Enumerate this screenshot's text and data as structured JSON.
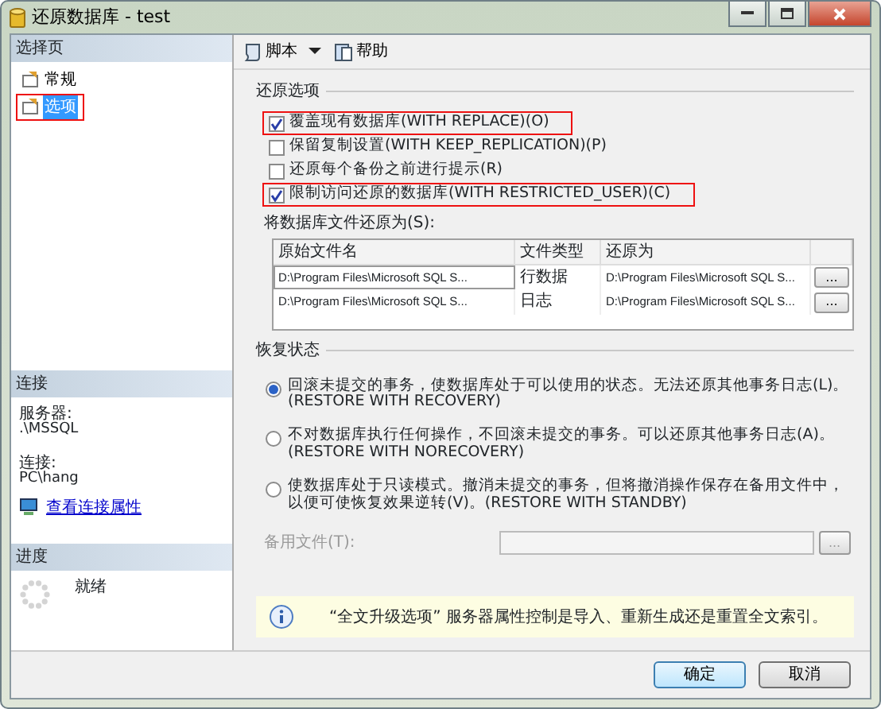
{
  "window": {
    "title": "还原数据库 - test"
  },
  "left": {
    "pages_heading": "选择页",
    "pages": [
      {
        "label": "常规",
        "selected": false,
        "highlighted": false
      },
      {
        "label": "选项",
        "selected": true,
        "highlighted": true
      }
    ],
    "connection_heading": "连接",
    "server_label": "服务器:",
    "server": ".\\MSSQL",
    "connection_label": "连接:",
    "connection": "PC\\hang",
    "link": "查看连接属性",
    "progress_heading": "进度",
    "progress_status": "就绪"
  },
  "toolbar": [
    {
      "label": "脚本",
      "kind": "script"
    },
    {
      "label": "帮助",
      "kind": "help"
    }
  ],
  "restore_options": {
    "heading": "还原选项",
    "checkboxes": [
      {
        "label": "覆盖现有数据库(WITH REPLACE)(O)",
        "checked": true,
        "highlighted": true
      },
      {
        "label": "保留复制设置(WITH KEEP_REPLICATION)(P)",
        "checked": false,
        "highlighted": false
      },
      {
        "label": "还原每个备份之前进行提示(R)",
        "checked": false,
        "highlighted": false
      },
      {
        "label": "限制访问还原的数据库(WITH RESTRICTED_USER)(C)",
        "checked": true,
        "highlighted": true
      }
    ],
    "files_label": "将数据库文件还原为(S):",
    "columns": [
      "原始文件名",
      "文件类型",
      "还原为"
    ],
    "rows": [
      {
        "cells": [
          "D:\\Program Files\\Microsoft SQL S...",
          "行数据",
          "D:\\Program Files\\Microsoft SQL S..."
        ],
        "selected": true
      },
      {
        "cells": [
          "D:\\Program Files\\Microsoft SQL S...",
          "日志",
          "D:\\Program Files\\Microsoft SQL S..."
        ],
        "selected": false
      }
    ],
    "browse_button": "..."
  },
  "recovery_state": {
    "heading": "恢复状态",
    "radios": [
      {
        "label": "回滚未提交的事务，使数据库处于可以使用的状态。无法还原其他事务日志(L)。(RESTORE WITH RECOVERY)",
        "selected": true
      },
      {
        "label": "不对数据库执行任何操作，不回滚未提交的事务。可以还原其他事务日志(A)。(RESTORE WITH NORECOVERY)",
        "selected": false
      },
      {
        "label": "使数据库处于只读模式。撤消未提交的事务，但将撤消操作保存在备用文件中，以便可使恢复效果逆转(V)。(RESTORE WITH STANDBY)",
        "selected": false
      }
    ],
    "standby_label": "备用文件(T):",
    "standby_disabled": true,
    "standby_browse": "..."
  },
  "info": "“全文升级选项” 服务器属性控制是导入、重新生成还是重置全文索引。",
  "buttons": [
    "确定",
    "取消"
  ]
}
